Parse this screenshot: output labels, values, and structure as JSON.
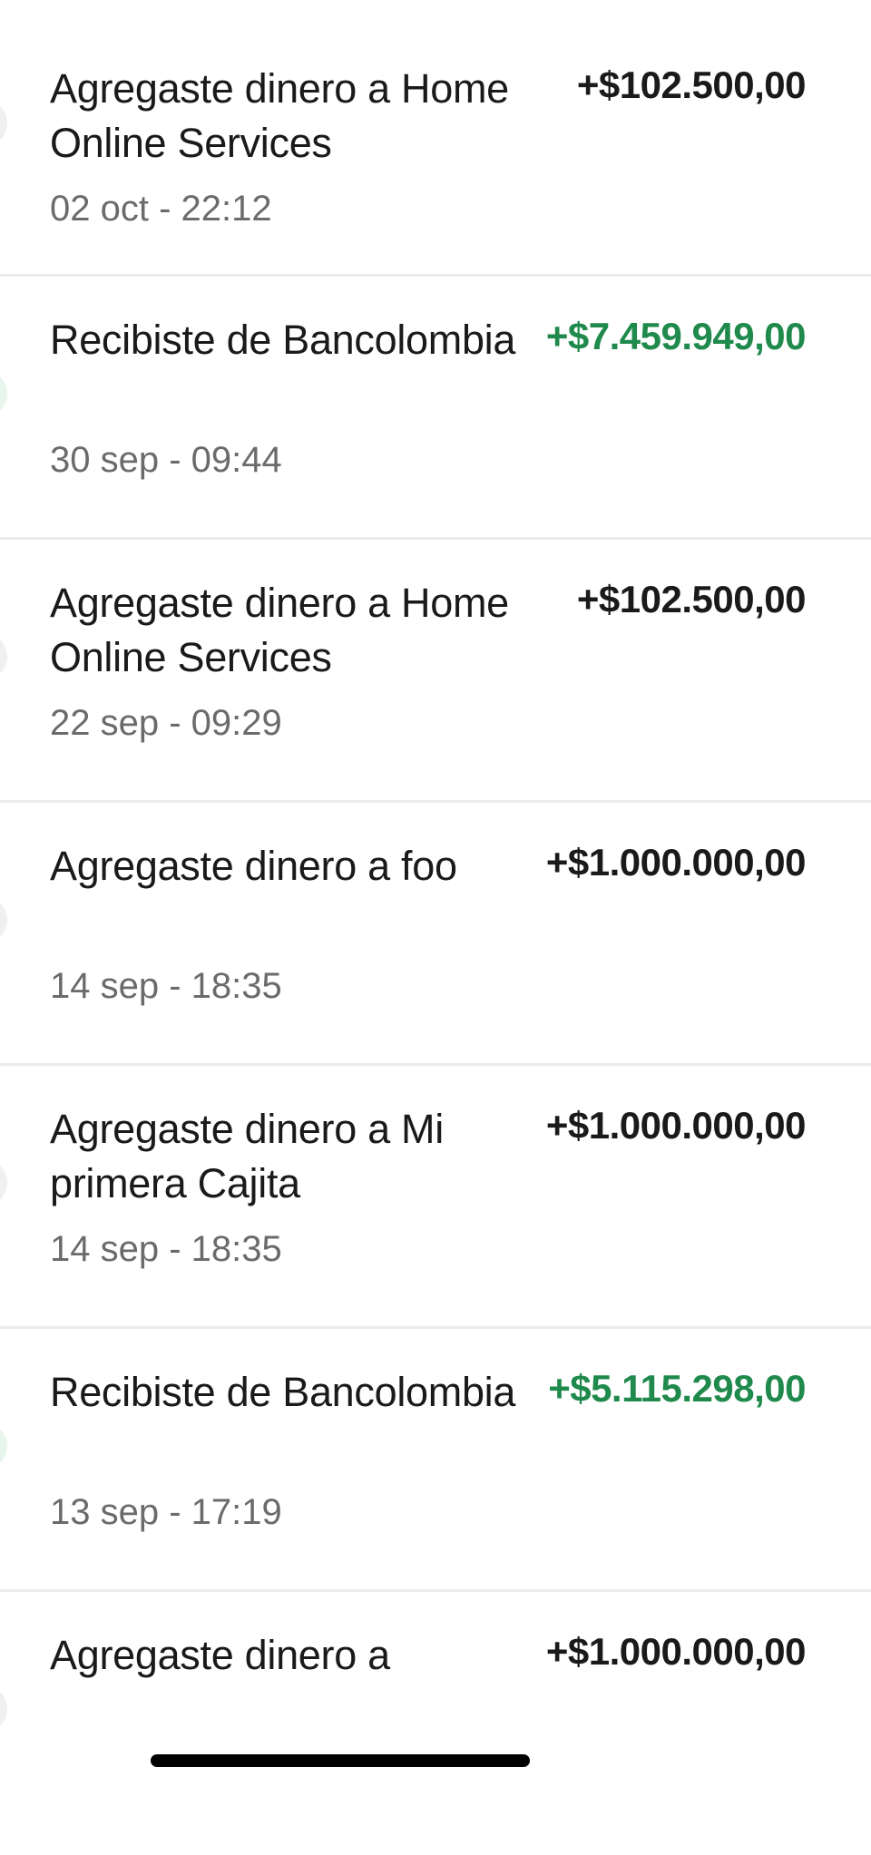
{
  "colors": {
    "incoming_green": "#1f8a4c",
    "text_primary": "#1a1a1a",
    "text_secondary": "#6b6b6b",
    "divider": "#ececec"
  },
  "transactions": [
    {
      "title": "Agregaste dinero a Home Online Services",
      "date": "02 oct - 22:12",
      "amount": "+$102.500,00",
      "green": false
    },
    {
      "title": "Recibiste de Bancolombia",
      "date": "30 sep - 09:44",
      "amount": "+$7.459.949,00",
      "green": true
    },
    {
      "title": "Agregaste dinero a Home Online Services",
      "date": "22 sep - 09:29",
      "amount": "+$102.500,00",
      "green": false
    },
    {
      "title": "Agregaste dinero a foo",
      "date": "14 sep - 18:35",
      "amount": "+$1.000.000,00",
      "green": false
    },
    {
      "title": "Agregaste dinero a Mi primera Cajita",
      "date": "14 sep - 18:35",
      "amount": "+$1.000.000,00",
      "green": false
    },
    {
      "title": "Recibiste de Bancolombia",
      "date": "13 sep - 17:19",
      "amount": "+$5.115.298,00",
      "green": true
    },
    {
      "title": "Agregaste dinero a",
      "date": "",
      "amount": "+$1.000.000,00",
      "green": false
    }
  ]
}
